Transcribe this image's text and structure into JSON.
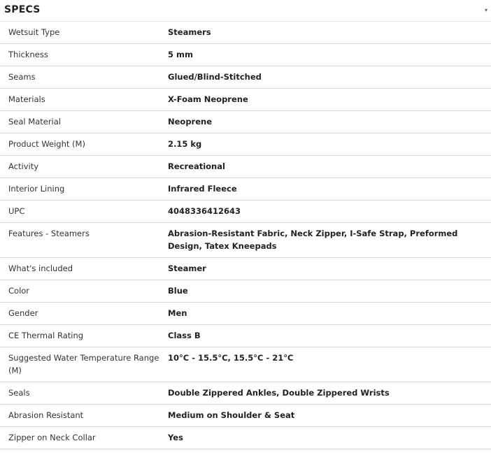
{
  "section": {
    "title": "SPECS",
    "toggle_icon": "chevron-collapse-icon"
  },
  "rows": [
    {
      "label": "Wetsuit Type",
      "value": "Steamers"
    },
    {
      "label": "Thickness",
      "value": "5 mm"
    },
    {
      "label": "Seams",
      "value": "Glued/Blind-Stitched"
    },
    {
      "label": "Materials",
      "value": "X-Foam Neoprene"
    },
    {
      "label": "Seal Material",
      "value": "Neoprene"
    },
    {
      "label": "Product Weight (M)",
      "value": "2.15 kg"
    },
    {
      "label": "Activity",
      "value": "Recreational"
    },
    {
      "label": "Interior Lining",
      "value": "Infrared Fleece"
    },
    {
      "label": "UPC",
      "value": "4048336412643"
    },
    {
      "label": "Features - Steamers",
      "value": "Abrasion-Resistant Fabric, Neck Zipper, I-Safe Strap, Preformed Design, Tatex Kneepads"
    },
    {
      "label": "What's included",
      "value": "Steamer"
    },
    {
      "label": "Color",
      "value": "Blue"
    },
    {
      "label": "Gender",
      "value": "Men"
    },
    {
      "label": "CE Thermal Rating",
      "value": "Class B"
    },
    {
      "label": "Suggested Water Temperature Range (M)",
      "value": "10°C - 15.5°C, 15.5°C - 21°C"
    },
    {
      "label": "Seals",
      "value": "Double Zippered Ankles, Double Zippered Wrists"
    },
    {
      "label": "Abrasion Resistant",
      "value": "Medium on Shoulder & Seat"
    },
    {
      "label": "Zipper on Neck Collar",
      "value": "Yes"
    }
  ]
}
